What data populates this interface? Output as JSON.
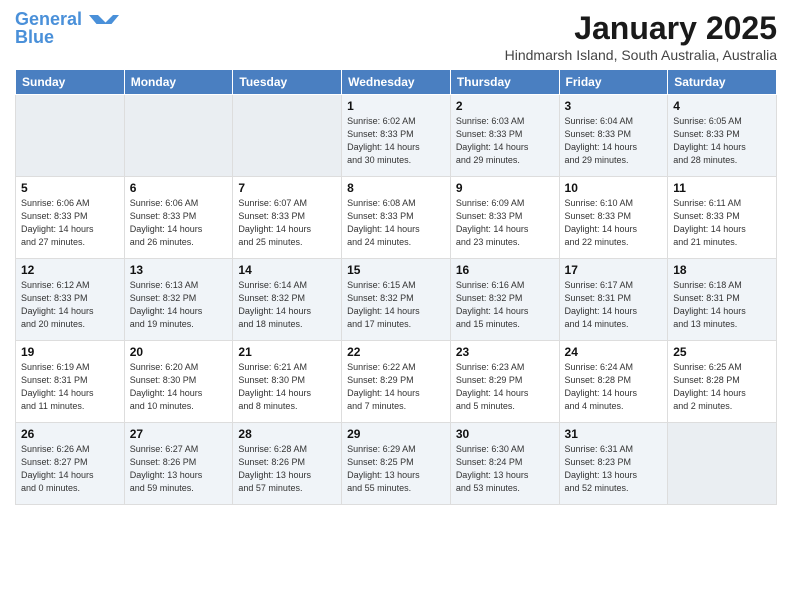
{
  "logo": {
    "line1": "General",
    "line2": "Blue"
  },
  "title": "January 2025",
  "subtitle": "Hindmarsh Island, South Australia, Australia",
  "weekdays": [
    "Sunday",
    "Monday",
    "Tuesday",
    "Wednesday",
    "Thursday",
    "Friday",
    "Saturday"
  ],
  "weeks": [
    [
      {
        "day": "",
        "info": ""
      },
      {
        "day": "",
        "info": ""
      },
      {
        "day": "",
        "info": ""
      },
      {
        "day": "1",
        "info": "Sunrise: 6:02 AM\nSunset: 8:33 PM\nDaylight: 14 hours\nand 30 minutes."
      },
      {
        "day": "2",
        "info": "Sunrise: 6:03 AM\nSunset: 8:33 PM\nDaylight: 14 hours\nand 29 minutes."
      },
      {
        "day": "3",
        "info": "Sunrise: 6:04 AM\nSunset: 8:33 PM\nDaylight: 14 hours\nand 29 minutes."
      },
      {
        "day": "4",
        "info": "Sunrise: 6:05 AM\nSunset: 8:33 PM\nDaylight: 14 hours\nand 28 minutes."
      }
    ],
    [
      {
        "day": "5",
        "info": "Sunrise: 6:06 AM\nSunset: 8:33 PM\nDaylight: 14 hours\nand 27 minutes."
      },
      {
        "day": "6",
        "info": "Sunrise: 6:06 AM\nSunset: 8:33 PM\nDaylight: 14 hours\nand 26 minutes."
      },
      {
        "day": "7",
        "info": "Sunrise: 6:07 AM\nSunset: 8:33 PM\nDaylight: 14 hours\nand 25 minutes."
      },
      {
        "day": "8",
        "info": "Sunrise: 6:08 AM\nSunset: 8:33 PM\nDaylight: 14 hours\nand 24 minutes."
      },
      {
        "day": "9",
        "info": "Sunrise: 6:09 AM\nSunset: 8:33 PM\nDaylight: 14 hours\nand 23 minutes."
      },
      {
        "day": "10",
        "info": "Sunrise: 6:10 AM\nSunset: 8:33 PM\nDaylight: 14 hours\nand 22 minutes."
      },
      {
        "day": "11",
        "info": "Sunrise: 6:11 AM\nSunset: 8:33 PM\nDaylight: 14 hours\nand 21 minutes."
      }
    ],
    [
      {
        "day": "12",
        "info": "Sunrise: 6:12 AM\nSunset: 8:33 PM\nDaylight: 14 hours\nand 20 minutes."
      },
      {
        "day": "13",
        "info": "Sunrise: 6:13 AM\nSunset: 8:32 PM\nDaylight: 14 hours\nand 19 minutes."
      },
      {
        "day": "14",
        "info": "Sunrise: 6:14 AM\nSunset: 8:32 PM\nDaylight: 14 hours\nand 18 minutes."
      },
      {
        "day": "15",
        "info": "Sunrise: 6:15 AM\nSunset: 8:32 PM\nDaylight: 14 hours\nand 17 minutes."
      },
      {
        "day": "16",
        "info": "Sunrise: 6:16 AM\nSunset: 8:32 PM\nDaylight: 14 hours\nand 15 minutes."
      },
      {
        "day": "17",
        "info": "Sunrise: 6:17 AM\nSunset: 8:31 PM\nDaylight: 14 hours\nand 14 minutes."
      },
      {
        "day": "18",
        "info": "Sunrise: 6:18 AM\nSunset: 8:31 PM\nDaylight: 14 hours\nand 13 minutes."
      }
    ],
    [
      {
        "day": "19",
        "info": "Sunrise: 6:19 AM\nSunset: 8:31 PM\nDaylight: 14 hours\nand 11 minutes."
      },
      {
        "day": "20",
        "info": "Sunrise: 6:20 AM\nSunset: 8:30 PM\nDaylight: 14 hours\nand 10 minutes."
      },
      {
        "day": "21",
        "info": "Sunrise: 6:21 AM\nSunset: 8:30 PM\nDaylight: 14 hours\nand 8 minutes."
      },
      {
        "day": "22",
        "info": "Sunrise: 6:22 AM\nSunset: 8:29 PM\nDaylight: 14 hours\nand 7 minutes."
      },
      {
        "day": "23",
        "info": "Sunrise: 6:23 AM\nSunset: 8:29 PM\nDaylight: 14 hours\nand 5 minutes."
      },
      {
        "day": "24",
        "info": "Sunrise: 6:24 AM\nSunset: 8:28 PM\nDaylight: 14 hours\nand 4 minutes."
      },
      {
        "day": "25",
        "info": "Sunrise: 6:25 AM\nSunset: 8:28 PM\nDaylight: 14 hours\nand 2 minutes."
      }
    ],
    [
      {
        "day": "26",
        "info": "Sunrise: 6:26 AM\nSunset: 8:27 PM\nDaylight: 14 hours\nand 0 minutes."
      },
      {
        "day": "27",
        "info": "Sunrise: 6:27 AM\nSunset: 8:26 PM\nDaylight: 13 hours\nand 59 minutes."
      },
      {
        "day": "28",
        "info": "Sunrise: 6:28 AM\nSunset: 8:26 PM\nDaylight: 13 hours\nand 57 minutes."
      },
      {
        "day": "29",
        "info": "Sunrise: 6:29 AM\nSunset: 8:25 PM\nDaylight: 13 hours\nand 55 minutes."
      },
      {
        "day": "30",
        "info": "Sunrise: 6:30 AM\nSunset: 8:24 PM\nDaylight: 13 hours\nand 53 minutes."
      },
      {
        "day": "31",
        "info": "Sunrise: 6:31 AM\nSunset: 8:23 PM\nDaylight: 13 hours\nand 52 minutes."
      },
      {
        "day": "",
        "info": ""
      }
    ]
  ]
}
